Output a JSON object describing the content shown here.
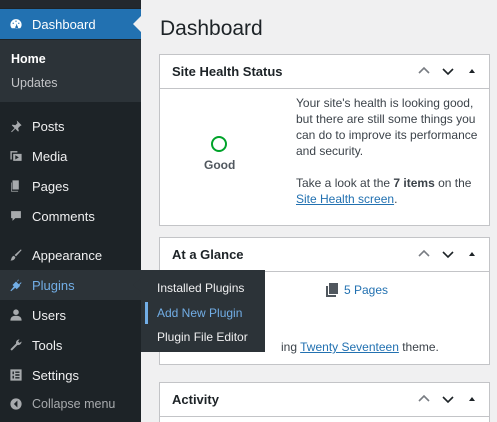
{
  "sidebar": {
    "dashboard_label": "Dashboard",
    "submenu": {
      "home": "Home",
      "updates": "Updates"
    },
    "items": [
      {
        "label": "Posts",
        "icon": "pin-icon"
      },
      {
        "label": "Media",
        "icon": "media-icon"
      },
      {
        "label": "Pages",
        "icon": "pages-icon"
      },
      {
        "label": "Comments",
        "icon": "comment-icon"
      },
      {
        "label": "Appearance",
        "icon": "brush-icon"
      },
      {
        "label": "Plugins",
        "icon": "plug-icon"
      },
      {
        "label": "Users",
        "icon": "user-icon"
      },
      {
        "label": "Tools",
        "icon": "wrench-icon"
      },
      {
        "label": "Settings",
        "icon": "settings-icon"
      }
    ],
    "collapse_label": "Collapse menu"
  },
  "plugins_flyout": {
    "items": [
      "Installed Plugins",
      "Add New Plugin",
      "Plugin File Editor"
    ]
  },
  "main": {
    "title": "Dashboard",
    "site_health": {
      "title": "Site Health Status",
      "status": "Good",
      "message": "Your site's health is looking good, but there are still some things you can do to improve its performance and security.",
      "prompt_prefix": "Take a look at the ",
      "items_count": "7 items",
      "prompt_middle": " on the ",
      "link": "Site Health screen",
      "prompt_suffix": "."
    },
    "at_a_glance": {
      "title": "At a Glance",
      "pages": "5 Pages",
      "theme_prefix": "ing ",
      "theme_link": "Twenty Seventeen",
      "theme_suffix": " theme."
    },
    "activity": {
      "title": "Activity"
    }
  },
  "colors": {
    "accent": "#2271b1",
    "sidebar": "#1d2327",
    "submenu": "#2c3338",
    "health_good": "#00a32a"
  }
}
